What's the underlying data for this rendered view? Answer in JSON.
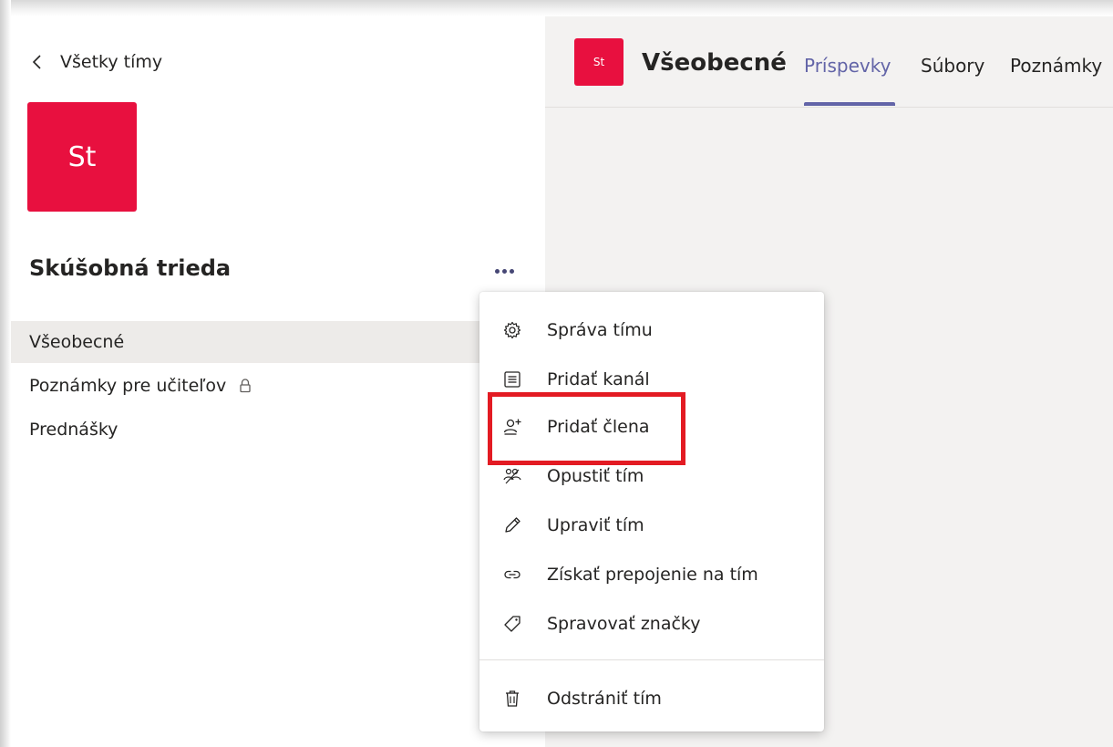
{
  "left_pane": {
    "back_label": "Všetky tímy",
    "team_avatar_initials": "St",
    "team_name": "Skúšobná trieda",
    "channels": [
      {
        "label": "Všeobecné",
        "active": true,
        "locked": false
      },
      {
        "label": "Poznámky pre učiteľov",
        "active": false,
        "locked": true
      },
      {
        "label": "Prednášky",
        "active": false,
        "locked": false
      }
    ]
  },
  "header": {
    "avatar_initials": "St",
    "channel_title": "Všeobecné",
    "tabs": [
      {
        "label": "Príspevky",
        "active": true
      },
      {
        "label": "Súbory",
        "active": false
      },
      {
        "label": "Poznámky",
        "active": false
      }
    ]
  },
  "menu": {
    "items": [
      {
        "label": "Správa tímu",
        "icon": "gear-icon"
      },
      {
        "label": "Pridať kanál",
        "icon": "channel-icon"
      },
      {
        "label": "Pridať člena",
        "icon": "add-member-icon"
      },
      {
        "label": "Opustiť tím",
        "icon": "leave-team-icon"
      },
      {
        "label": "Upraviť tím",
        "icon": "pencil-icon"
      },
      {
        "label": "Získať prepojenie na tím",
        "icon": "link-icon"
      },
      {
        "label": "Spravovať značky",
        "icon": "tag-icon"
      },
      {
        "label": "Odstrániť tím",
        "icon": "trash-icon"
      }
    ]
  },
  "colors": {
    "accent": "#6264a7",
    "team_avatar": "#e8103f",
    "highlight": "#e31b23"
  }
}
